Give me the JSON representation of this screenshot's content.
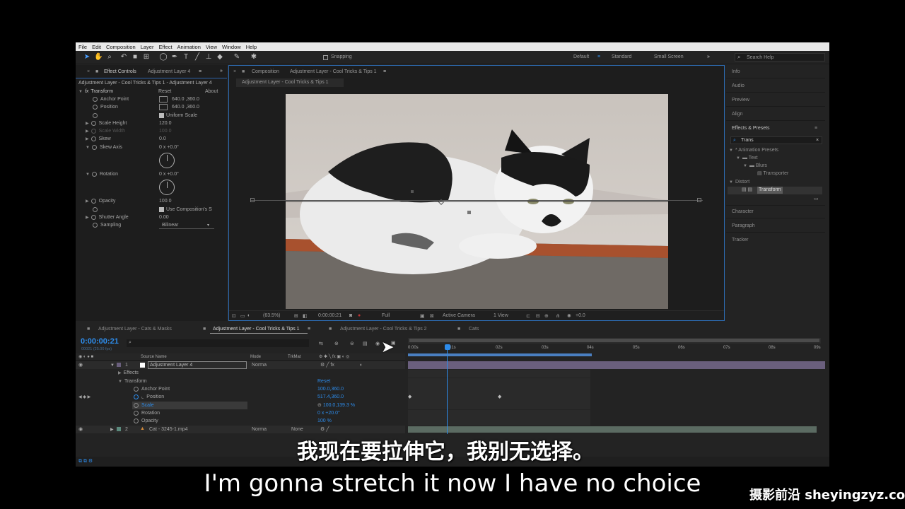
{
  "menu": [
    "File",
    "Edit",
    "Composition",
    "Layer",
    "Effect",
    "Animation",
    "View",
    "Window",
    "Help"
  ],
  "toolbar": {
    "snapping_label": "Snapping",
    "workspaces": [
      "Default",
      "Standard",
      "Small Screen"
    ],
    "search_placeholder": "Search Help"
  },
  "effect_controls": {
    "tab_prefix": "Effect Controls",
    "tab_layer": "Adjustment Layer 4",
    "breadcrumb": "Adjustment Layer - Cool Tricks & Tips 1 - Adjustment Layer 4",
    "effect_name": "Transform",
    "reset_label": "Reset",
    "about_label": "About",
    "anchor_point": {
      "label": "Anchor Point",
      "value": "640.0 ,360.0"
    },
    "position": {
      "label": "Position",
      "value": "640.0 ,360.0"
    },
    "uniform_scale": "Uniform Scale",
    "scale_height": {
      "label": "Scale Height",
      "value": "120.0"
    },
    "scale_width": {
      "label": "Scale Width",
      "value": "100.0"
    },
    "skew": {
      "label": "Skew",
      "value": "0.0"
    },
    "skew_axis": {
      "label": "Skew Axis",
      "value": "0 x +0.0°"
    },
    "rotation": {
      "label": "Rotation",
      "value": "0 x +0.0°"
    },
    "opacity": {
      "label": "Opacity",
      "value": "100.0"
    },
    "use_comp_shutter": "Use Composition's S",
    "shutter_angle": {
      "label": "Shutter Angle",
      "value": "0.00"
    },
    "sampling": {
      "label": "Sampling",
      "value": "Bilinear"
    }
  },
  "composition": {
    "tab_prefix": "Composition",
    "tab_name": "Adjustment Layer - Cool Tricks & Tips 1",
    "sub_tab": "Adjustment Layer - Cool Tricks & Tips 1",
    "zoom": "(63.5%)",
    "timecode": "0:00:00:21",
    "resolution": "Full",
    "camera": "Active Camera",
    "view": "1 View",
    "exposure": "+0.0"
  },
  "right_panel": {
    "items": [
      "Info",
      "Audio",
      "Preview",
      "Align"
    ],
    "effects_presets": "Effects & Presets",
    "search_value": "Trans",
    "tree": {
      "animation_presets": "* Animation Presets",
      "text": "Text",
      "blurs": "Blurs",
      "transporter": "Transporter",
      "distort": "Distort",
      "transform": "Transform"
    },
    "bottom_items": [
      "Character",
      "Paragraph",
      "Tracker"
    ]
  },
  "timeline": {
    "tabs": [
      "Adjustment Layer - Cats & Masks",
      "Adjustment Layer - Cool Tricks & Tips 1",
      "Adjustment Layer - Cool Tricks & Tips 2",
      "Cats"
    ],
    "timecode": "0:00:00:21",
    "frame_info": "00021 (25.00 fps)",
    "search_placeholder": "",
    "columns": {
      "source_name": "Source Name",
      "mode": "Mode",
      "trkmat": "TrkMat"
    },
    "layer1": {
      "num": "1",
      "name": "Adjustment Layer 4",
      "mode": "Norma"
    },
    "effects_label": "Effects",
    "transform_label": "Transform",
    "reset_label": "Reset",
    "props": [
      {
        "label": "Anchor Point",
        "value": "100.0,360.0"
      },
      {
        "label": "Position",
        "value": "517.4,360.0"
      },
      {
        "label": "Scale",
        "value": "100.0,139.3 %"
      },
      {
        "label": "Rotation",
        "value": "0 x +20.0°"
      },
      {
        "label": "Opacity",
        "value": "100 %"
      }
    ],
    "layer2": {
      "num": "2",
      "name": "Cat - 3245-1.mp4",
      "mode": "Norma",
      "trkmat": "None"
    },
    "ruler": [
      "0:00s",
      "01s",
      "02s",
      "03s",
      "04s",
      "05s",
      "06s",
      "07s",
      "08s",
      "09s"
    ]
  },
  "subtitles": {
    "zh": "我现在要拉伸它，我别无选择。",
    "en": "I'm gonna stretch it now I have no choice"
  },
  "watermark": "摄影前沿 sheyingzyz.com",
  "colors": {
    "accent": "#2d8ceb",
    "layer_bar": "#6a5f7d",
    "layer2_bar": "#5b6b62"
  }
}
